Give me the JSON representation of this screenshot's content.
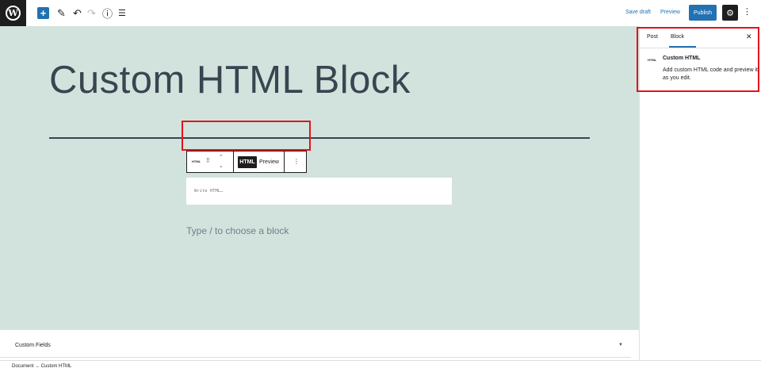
{
  "topbar": {
    "logo_glyph": "W",
    "add_glyph": "+",
    "tools_glyph": "✎",
    "undo_glyph": "↶",
    "redo_glyph": "↷",
    "details_glyph": "ⓘ",
    "outline_glyph": "☰",
    "save_draft": "Save draft",
    "preview": "Preview",
    "publish": "Publish",
    "settings_glyph": "⚙",
    "more_glyph": "⋮"
  },
  "editor": {
    "title": "Custom HTML Block",
    "block_toolbar": {
      "block_icon": "HTML",
      "drag_glyph": "⁝⁝",
      "mover_up": "⌃",
      "mover_down": "⌄",
      "html_tab": "HTML",
      "preview_tab": "Preview",
      "more_glyph": "⋮"
    },
    "html_placeholder": "Write HTML…",
    "append_hint": "Type / to choose a block"
  },
  "meta_boxes": {
    "custom_fields": "Custom Fields",
    "toggle_glyph": "▼"
  },
  "footer": {
    "breadcrumb": "Document → Custom HTML"
  },
  "sidebar": {
    "tab_post": "Post",
    "tab_block": "Block",
    "close_glyph": "✕",
    "block_icon": "HTML",
    "block_title": "Custom HTML",
    "block_description": "Add custom HTML code and preview it as you edit."
  },
  "colors": {
    "accent": "#2271b1",
    "canvas_bg": "#d2e3de",
    "highlight": "#e3131b",
    "dark": "#1e1e1e"
  }
}
